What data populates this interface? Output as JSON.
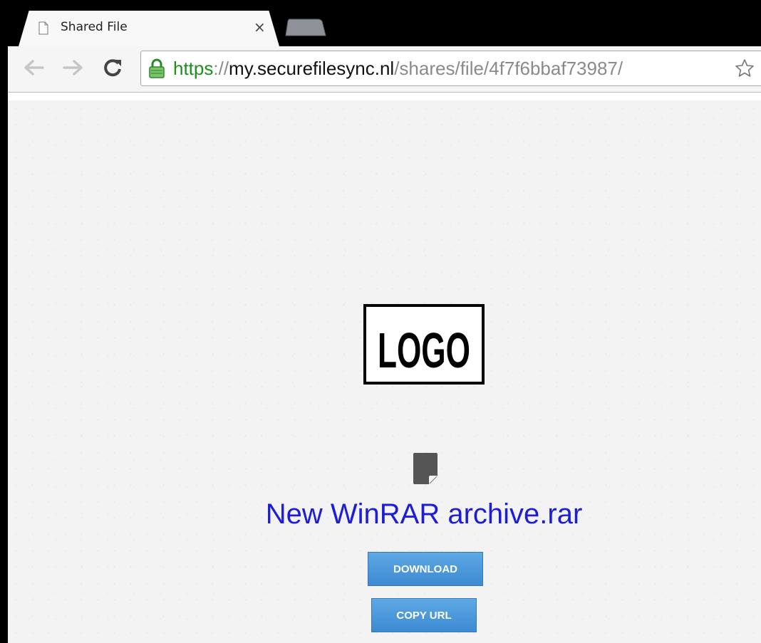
{
  "browser": {
    "tab": {
      "title": "Shared File",
      "close_glyph": "×",
      "icon": "document-icon"
    },
    "toolbar": {
      "back_icon": "back-arrow-icon",
      "forward_icon": "forward-arrow-icon",
      "reload_icon": "reload-icon",
      "bookmark_icon": "star-icon"
    },
    "address": {
      "scheme": "https",
      "separator": "://",
      "host": "my.securefilesync.nl",
      "path": "/shares/file/4f7f6bbaf73987/",
      "secure_icon": "lock-icon"
    }
  },
  "page": {
    "logo_text": "LOGO",
    "file": {
      "icon": "file-icon",
      "name": "New WinRAR archive.rar"
    },
    "buttons": {
      "download": "DOWNLOAD",
      "copy_url": "COPY URL"
    },
    "colors": {
      "filename": "#1d1dd8",
      "button": "#4a97d9",
      "url_scheme": "#1d8f1d"
    }
  }
}
